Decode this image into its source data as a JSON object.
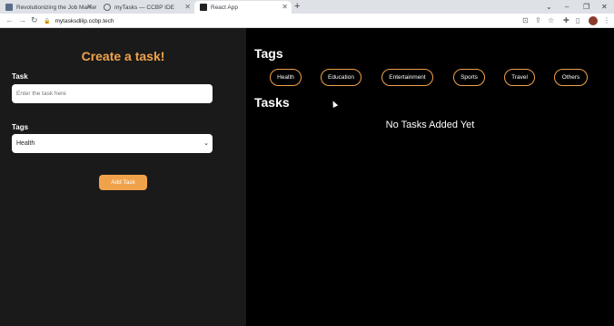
{
  "browser": {
    "tabs": [
      {
        "title": "Revolutionizing the Job Market |",
        "active": false
      },
      {
        "title": "myTasks — CCBP IDE",
        "active": false
      },
      {
        "title": "React App",
        "active": true
      }
    ],
    "url": "mytasksdilip.ccbp.tech"
  },
  "form": {
    "title": "Create a task!",
    "task_label": "Task",
    "task_placeholder": "Enter the task here",
    "tags_label": "Tags",
    "selected_tag": "Health",
    "add_button": "Add Task"
  },
  "main": {
    "tags_heading": "Tags",
    "tags": [
      "Health",
      "Education",
      "Entertainment",
      "Sports",
      "Travel",
      "Others"
    ],
    "tasks_heading": "Tasks",
    "empty_message": "No Tasks Added Yet"
  },
  "colors": {
    "accent": "#f0a24b",
    "left_panel_bg": "#1a1a1a",
    "right_panel_bg": "#000000"
  }
}
